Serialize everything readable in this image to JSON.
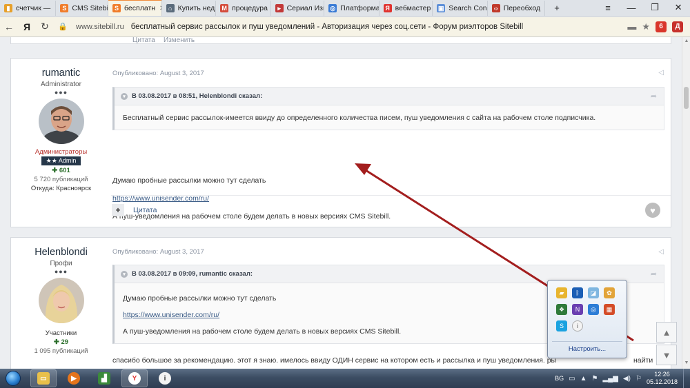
{
  "tabs": [
    {
      "label": "счетчик — ",
      "color": "#e7a02b",
      "glyph": "▮"
    },
    {
      "label": "CMS Sitebi",
      "color": "#f07c2b",
      "glyph": "S"
    },
    {
      "label": "бесплатн",
      "color": "#f07c2b",
      "glyph": "S",
      "active": true
    },
    {
      "label": "Купить нед",
      "color": "#5a6b7c",
      "glyph": "⌂"
    },
    {
      "label": "процедура",
      "color": "#d44b3a",
      "glyph": "M"
    },
    {
      "label": "Сериал Изв",
      "color": "#c23838",
      "glyph": "▸"
    },
    {
      "label": "Платформа",
      "color": "#3a7bd5",
      "glyph": "◎"
    },
    {
      "label": "вебмастер",
      "color": "#e0332f",
      "glyph": "Я"
    },
    {
      "label": "Search Cons",
      "color": "#5d8fd8",
      "glyph": "▣"
    },
    {
      "label": "Переобход",
      "color": "#c0392b",
      "glyph": "‹›"
    }
  ],
  "window_controls": {
    "menu": "≡",
    "minimize": "—",
    "restore": "❐",
    "close": "✕",
    "new_tab": "+"
  },
  "address": {
    "host": "www.sitebill.ru",
    "title": "бесплатный сервис рассылок и пуш уведомлений - Авторизация через соц.сети - Форум риэлторов Sitebill"
  },
  "prev_post": {
    "quote_label": "Цитата",
    "edit_label": "Изменить"
  },
  "post1": {
    "author": "rumantic",
    "group": "Administrator",
    "role": "Администраторы",
    "badge": "Admin",
    "badge_stars": "★★",
    "reputation": "601",
    "posts": "5 720 публикаций",
    "city": "Откуда: Красноярск",
    "published": "Опубликовано: August 3, 2017",
    "quote_author": "В 03.08.2017 в 08:51, Helenblondi сказал:",
    "quote_text": "Бесплатный сервис рассылок-имеется ввиду до определенного количества писем, пуш уведомления с сайта на рабочем столе подписчика.",
    "line1": "Думаю пробные рассылки можно тут сделать",
    "link": "https://www.unisender.com/ru/",
    "line2": "А пуш-уведомления на рабочем столе будем делать в новых версиях CMS Sitebill.",
    "quote_action": "Цитата"
  },
  "post2": {
    "author": "Helenblondi",
    "group": "Профи",
    "role": "Участники",
    "reputation": "29",
    "posts": "1 095 публикаций",
    "published": "Опубликовано: August 3, 2017",
    "quote_author": "В 03.08.2017 в 09:09, rumantic сказал:",
    "quote_line1": "Думаю пробные рассылки можно тут сделать",
    "quote_link": "https://www.unisender.com/ru/",
    "quote_line2": "А пуш-уведомления на рабочем столе будем делать в новых версиях CMS Sitebill.",
    "text": "спасибо большое за рекомендацию. этот я знаю. имелось ввиду ОДИН сервис на котором есть и рассылка и пуш уведомления. ры",
    "text_tail": "найти"
  },
  "tray_popup": {
    "customize": "Настроить..."
  },
  "taskbar": {
    "lang": "BG",
    "time": "12:26",
    "date": "05.12.2018"
  },
  "colors": {
    "accent_tab": "#f08c3a",
    "arrow": "#a31e1e",
    "admin_role": "#b8302a"
  }
}
